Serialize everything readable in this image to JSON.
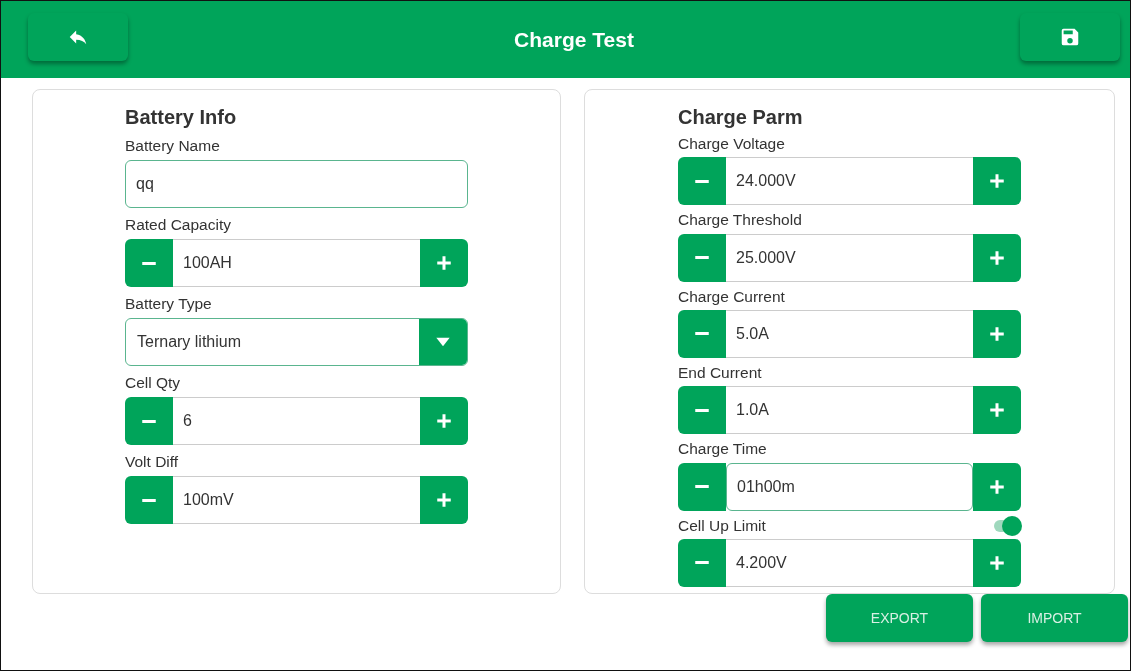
{
  "header": {
    "title": "Charge Test"
  },
  "panels": [
    {
      "title": "Battery Info",
      "fields": [
        {
          "label": "Battery Name",
          "kind": "text",
          "value": "qq",
          "focused": true
        },
        {
          "label": "Rated Capacity",
          "kind": "stepper",
          "value": "100AH",
          "focused": false
        },
        {
          "label": "Battery Type",
          "kind": "dropdown",
          "value": "Ternary lithium",
          "focused": false
        },
        {
          "label": "Cell Qty",
          "kind": "stepper",
          "value": "6",
          "focused": false
        },
        {
          "label": "Volt Diff",
          "kind": "stepper",
          "value": "100mV",
          "focused": false
        }
      ]
    },
    {
      "title": "Charge Parm",
      "fields": [
        {
          "label": "Charge Voltage",
          "kind": "stepper",
          "value": "24.000V",
          "focused": false
        },
        {
          "label": "Charge Threshold",
          "kind": "stepper",
          "value": "25.000V",
          "focused": false
        },
        {
          "label": "Charge Current",
          "kind": "stepper",
          "value": "5.0A",
          "focused": false
        },
        {
          "label": "End Current",
          "kind": "stepper",
          "value": "1.0A",
          "focused": false
        },
        {
          "label": "Charge Time",
          "kind": "stepper",
          "value": "01h00m",
          "focused": true
        },
        {
          "label": "Cell Up Limit",
          "kind": "stepper",
          "value": "4.200V",
          "focused": false,
          "toggle": {
            "on": true
          }
        }
      ]
    }
  ],
  "buttons": [
    "EXPORT",
    "IMPORT"
  ]
}
